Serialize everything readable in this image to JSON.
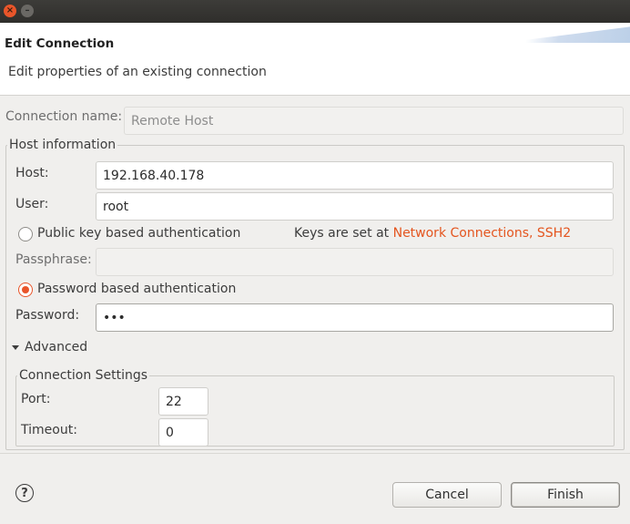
{
  "window": {
    "close_glyph": "×",
    "minimize_glyph": "–"
  },
  "header": {
    "title": "Edit Connection",
    "description": "Edit properties of an existing connection"
  },
  "connection_name": {
    "label": "Connection name:",
    "value": "Remote Host"
  },
  "host_info": {
    "title": "Host information",
    "host_label": "Host:",
    "host_value": "192.168.40.178",
    "user_label": "User:",
    "user_value": "root",
    "public_key_label": "Public key based authentication",
    "public_key_selected": false,
    "keys_note": "Keys are set at ",
    "keys_link": "Network Connections, SSH2",
    "passphrase_label": "Passphrase:",
    "passphrase_value": "",
    "password_auth_label": "Password based authentication",
    "password_auth_selected": true,
    "password_label": "Password:",
    "password_value": "•••",
    "advanced_label": "Advanced",
    "advanced_expanded": true
  },
  "connection_settings": {
    "title": "Connection Settings",
    "port_label": "Port:",
    "port_value": "22",
    "timeout_label": "Timeout:",
    "timeout_value": "0"
  },
  "footer": {
    "help_glyph": "?",
    "cancel_label": "Cancel",
    "finish_label": "Finish"
  },
  "colors": {
    "accent": "#e9552a",
    "link": "#e4551f",
    "titlebar": "#2f2e2b",
    "dialog_bg": "#f0efed"
  }
}
